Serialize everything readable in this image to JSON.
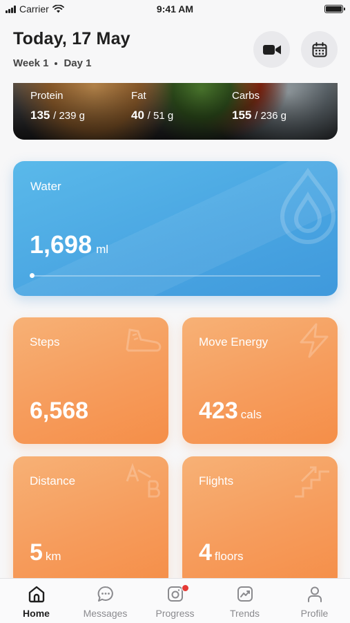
{
  "status_bar": {
    "carrier": "Carrier",
    "time": "9:41 AM"
  },
  "header": {
    "title": "Today, 17 May",
    "week": "Week 1",
    "day": "Day 1",
    "buttons": {
      "video_icon": "video-camera-icon",
      "calendar_icon": "calendar-icon"
    }
  },
  "macros": {
    "protein": {
      "label": "Protein",
      "value": "135",
      "total": "/ 239 g"
    },
    "fat": {
      "label": "Fat",
      "value": "40",
      "total": "/ 51 g"
    },
    "carbs": {
      "label": "Carbs",
      "value": "155",
      "total": "/ 236 g"
    }
  },
  "water": {
    "label": "Water",
    "value": "1,698",
    "unit": "ml",
    "progress": 0.0,
    "color": "#4aa6e2"
  },
  "stats": {
    "steps": {
      "label": "Steps",
      "value": "6,568",
      "unit": ""
    },
    "move_energy": {
      "label": "Move Energy",
      "value": "423",
      "unit": "cals"
    },
    "distance": {
      "label": "Distance",
      "value": "5",
      "unit": "km"
    },
    "flights": {
      "label": "Flights",
      "value": "4",
      "unit": "floors"
    },
    "tile_color": "#f69c5c"
  },
  "tabs": [
    {
      "label": "Home",
      "icon": "home-icon",
      "active": true
    },
    {
      "label": "Messages",
      "icon": "chat-bubble-icon",
      "active": false
    },
    {
      "label": "Progress",
      "icon": "camera-icon",
      "active": false,
      "badge": true
    },
    {
      "label": "Trends",
      "icon": "trend-chart-icon",
      "active": false
    },
    {
      "label": "Profile",
      "icon": "person-icon",
      "active": false
    }
  ]
}
